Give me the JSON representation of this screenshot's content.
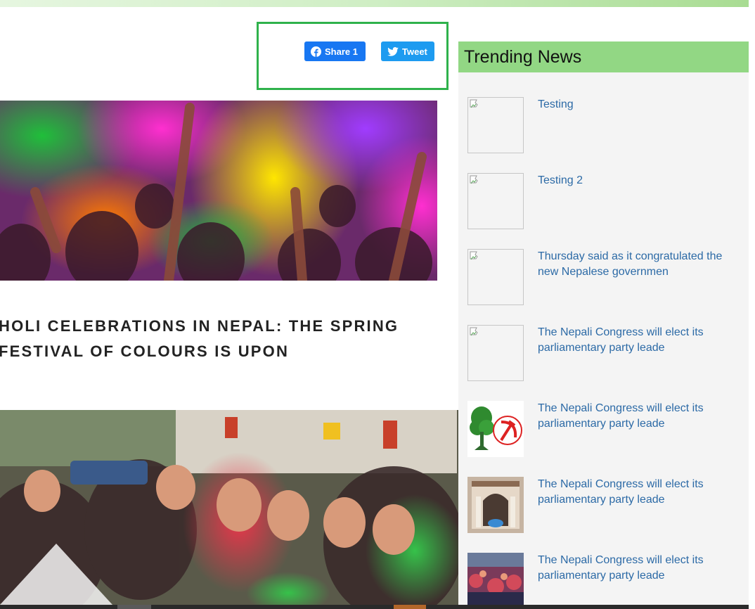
{
  "share": {
    "facebook_label": "Share 1",
    "twitter_label": "Tweet",
    "colors": {
      "facebook": "#1877f2",
      "twitter": "#1d9bf0",
      "highlight_border": "#2fb24c"
    }
  },
  "article": {
    "title": "HOLI CELEBRATIONS IN NEPAL: THE SPRING FESTIVAL OF COLOURS IS UPON",
    "hero_image": "holi-colour-powder-crowd-photo",
    "second_image": "holi-selfie-crowd-photo"
  },
  "sidebar": {
    "title": "Trending News",
    "header_color": "#92d784",
    "items": [
      {
        "text": "Testing",
        "thumb": "broken-image-icon"
      },
      {
        "text": "Testing 2",
        "thumb": "broken-image-icon"
      },
      {
        "text": "Thursday said as it congratulated the new Nepalese governmen",
        "thumb": "broken-image-icon"
      },
      {
        "text": "The Nepali Congress will elect its parliamentary party leade",
        "thumb": "broken-image-icon"
      },
      {
        "text": "The Nepali Congress will elect its parliamentary party leade",
        "thumb": "tree-and-hammer-sickle-logos"
      },
      {
        "text": "The Nepali Congress will elect its parliamentary party leade",
        "thumb": "building-with-car-photo"
      },
      {
        "text": "The Nepali Congress will elect its parliamentary party leade",
        "thumb": "crowd-photo"
      }
    ]
  }
}
